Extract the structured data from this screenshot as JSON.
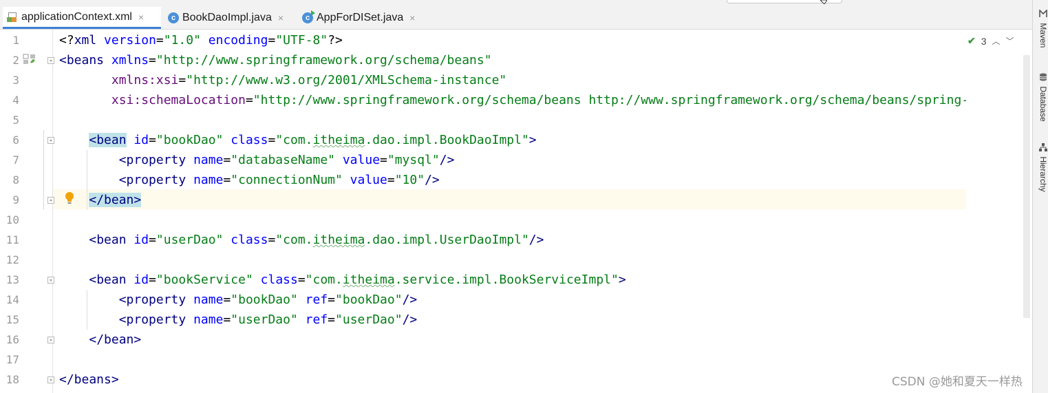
{
  "tabs": [
    {
      "label": "applicationContext.xml",
      "icon": "xml-file-icon",
      "active": true
    },
    {
      "label": "BookDaoImpl.java",
      "icon": "java-class-icon",
      "active": false
    },
    {
      "label": "AppForDISet.java",
      "icon": "java-runnable-class-icon",
      "active": false
    }
  ],
  "close_glyph": "×",
  "lines": [
    {
      "n": "1",
      "text": "<?xml version=\"1.0\" encoding=\"UTF-8\"?>"
    },
    {
      "n": "2",
      "text": "<beans xmlns=\"http://www.springframework.org/schema/beans\""
    },
    {
      "n": "3",
      "text": "       xmlns:xsi=\"http://www.w3.org/2001/XMLSchema-instance\""
    },
    {
      "n": "4",
      "text": "       xsi:schemaLocation=\"http://www.springframework.org/schema/beans http://www.springframework.org/schema/beans/spring-beans.xsd\">"
    },
    {
      "n": "5",
      "text": ""
    },
    {
      "n": "6",
      "text": "    <bean id=\"bookDao\" class=\"com.itheima.dao.impl.BookDaoImpl\">"
    },
    {
      "n": "7",
      "text": "        <property name=\"databaseName\" value=\"mysql\"/>"
    },
    {
      "n": "8",
      "text": "        <property name=\"connectionNum\" value=\"10\"/>"
    },
    {
      "n": "9",
      "text": "    </bean>"
    },
    {
      "n": "10",
      "text": ""
    },
    {
      "n": "11",
      "text": "    <bean id=\"userDao\" class=\"com.itheima.dao.impl.UserDaoImpl\"/>"
    },
    {
      "n": "12",
      "text": ""
    },
    {
      "n": "13",
      "text": "    <bean id=\"bookService\" class=\"com.itheima.service.impl.BookServiceImpl\">"
    },
    {
      "n": "14",
      "text": "        <property name=\"bookDao\" ref=\"bookDao\"/>"
    },
    {
      "n": "15",
      "text": "        <property name=\"userDao\" ref=\"userDao\"/>"
    },
    {
      "n": "16",
      "text": "    </bean>"
    },
    {
      "n": "17",
      "text": ""
    },
    {
      "n": "18",
      "text": "</beans>"
    }
  ],
  "inspection": {
    "count": "3",
    "icon": "checkmark-icon"
  },
  "side_tools": [
    {
      "label": "Maven",
      "icon": "maven-icon"
    },
    {
      "label": "Database",
      "icon": "database-icon"
    },
    {
      "label": "Hierarchy",
      "icon": "hierarchy-icon"
    }
  ],
  "watermark": "CSDN @她和夏天一样热",
  "colors": {
    "tag": "#000080",
    "attr_name": "#0000ff",
    "namespace": "#660e7a",
    "attr_value": "#067d17",
    "match_highlight": "#bfe3e8",
    "caret_line": "#fefbed",
    "active_tab_underline": "#3d7fd6"
  }
}
